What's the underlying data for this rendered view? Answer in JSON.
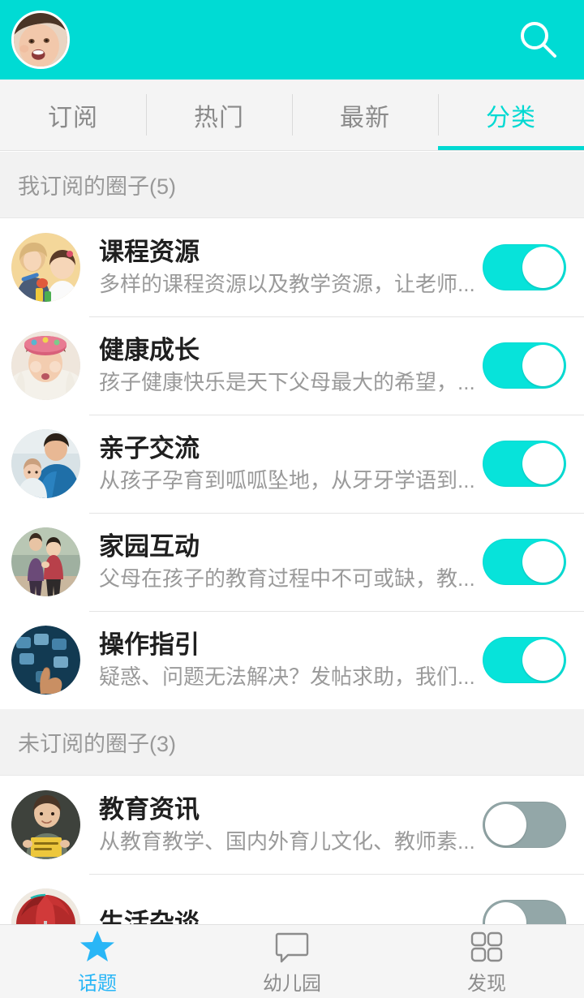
{
  "header": {
    "avatar_name": "user-avatar",
    "search_icon": "search-icon",
    "background_color": "#00DBD4"
  },
  "tabs": [
    {
      "label": "订阅",
      "active": false
    },
    {
      "label": "热门",
      "active": false
    },
    {
      "label": "最新",
      "active": false
    },
    {
      "label": "分类",
      "active": true
    }
  ],
  "sections": [
    {
      "header": "我订阅的圈子(5)",
      "items": [
        {
          "title": "课程资源",
          "desc": "多样的课程资源以及教学资源，让老师...",
          "toggle": "on",
          "thumb": "teacher-child-photo"
        },
        {
          "title": "健康成长",
          "desc": "孩子健康快乐是天下父母最大的希望，...",
          "toggle": "on",
          "thumb": "child-hat-photo"
        },
        {
          "title": "亲子交流",
          "desc": "从孩子孕育到呱呱坠地，从牙牙学语到...",
          "toggle": "on",
          "thumb": "father-baby-photo"
        },
        {
          "title": "家园互动",
          "desc": "父母在孩子的教育过程中不可或缺，教...",
          "toggle": "on",
          "thumb": "parent-child-walk-photo"
        },
        {
          "title": "操作指引",
          "desc": "疑惑、问题无法解决？发帖求助，我们...",
          "toggle": "on",
          "thumb": "hand-touch-screen-photo"
        }
      ]
    },
    {
      "header": "未订阅的圈子(3)",
      "items": [
        {
          "title": "教育资讯",
          "desc": "从教育教学、国内外育儿文化、教师素...",
          "toggle": "off",
          "thumb": "boy-learn-book-photo"
        },
        {
          "title": "生活杂谈",
          "desc": "",
          "toggle": "off",
          "thumb": "red-umbrella-photo"
        }
      ]
    }
  ],
  "bottom_nav": [
    {
      "label": "话题",
      "icon": "star-icon",
      "active": true
    },
    {
      "label": "幼儿园",
      "icon": "speech-bubble-icon",
      "active": false
    },
    {
      "label": "发现",
      "icon": "grid-icon",
      "active": false
    }
  ],
  "colors": {
    "accent": "#00DBD4",
    "toggle_on": "#07E3DA",
    "toggle_off": "#93A7A8",
    "nav_active": "#29B6F6"
  }
}
